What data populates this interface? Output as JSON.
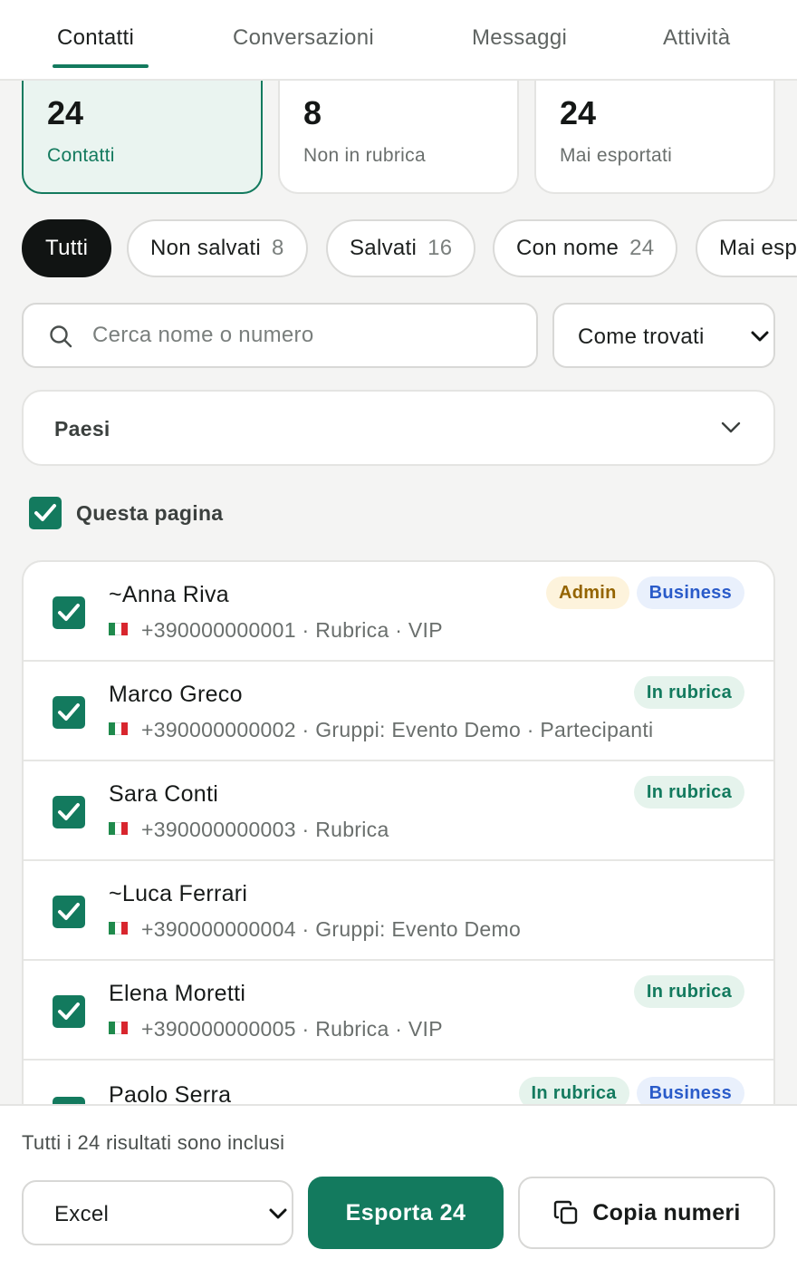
{
  "tabs": [
    {
      "label": "Contatti",
      "active": true
    },
    {
      "label": "Conversazioni",
      "active": false
    },
    {
      "label": "Messaggi",
      "active": false
    },
    {
      "label": "Attività",
      "active": false
    }
  ],
  "stats": [
    {
      "value": "24",
      "label": "Contatti",
      "active": true
    },
    {
      "value": "8",
      "label": "Non in rubrica",
      "active": false
    },
    {
      "value": "24",
      "label": "Mai esportati",
      "active": false
    }
  ],
  "filters": [
    {
      "label": "Tutti",
      "count": "",
      "active": true
    },
    {
      "label": "Non salvati",
      "count": "8",
      "active": false
    },
    {
      "label": "Salvati",
      "count": "16",
      "active": false
    },
    {
      "label": "Con nome",
      "count": "24",
      "active": false
    },
    {
      "label": "Mai esportati",
      "count": "",
      "active": false
    }
  ],
  "search": {
    "placeholder": "Cerca nome o numero",
    "value": ""
  },
  "sort": {
    "selected": "Come trovati"
  },
  "countries": {
    "label": "Paesi"
  },
  "page_select": {
    "label": "Questa pagina",
    "checked": true
  },
  "contacts": [
    {
      "name": "~Anna Riva",
      "phone": "+390000000001",
      "details": "Rubrica · VIP",
      "badges": [
        {
          "label": "Admin",
          "kind": "admin"
        },
        {
          "label": "Business",
          "kind": "business"
        }
      ]
    },
    {
      "name": "Marco Greco",
      "phone": "+390000000002",
      "details": "Gruppi: Evento Demo · Partecipanti",
      "badges": [
        {
          "label": "In rubrica",
          "kind": "rubrica"
        }
      ]
    },
    {
      "name": "Sara Conti",
      "phone": "+390000000003",
      "details": "Rubrica",
      "badges": [
        {
          "label": "In rubrica",
          "kind": "rubrica"
        }
      ]
    },
    {
      "name": "~Luca Ferrari",
      "phone": "+390000000004",
      "details": "Gruppi: Evento Demo",
      "badges": []
    },
    {
      "name": "Elena Moretti",
      "phone": "+390000000005",
      "details": "Rubrica · VIP",
      "badges": [
        {
          "label": "In rubrica",
          "kind": "rubrica"
        }
      ]
    },
    {
      "name": "Paolo Serra",
      "phone": "",
      "details": "",
      "badges": [
        {
          "label": "In rubrica",
          "kind": "rubrica"
        },
        {
          "label": "Business",
          "kind": "business"
        }
      ]
    }
  ],
  "footer": {
    "info": "Tutti i 24 risultati sono inclusi",
    "format": "Excel",
    "export_label": "Esporta 24",
    "copy_label": "Copia numeri"
  },
  "colors": {
    "accent": "#137a5e",
    "flag_green": "#1f8a4c",
    "flag_white": "#ffffff",
    "flag_red": "#d8262e"
  }
}
